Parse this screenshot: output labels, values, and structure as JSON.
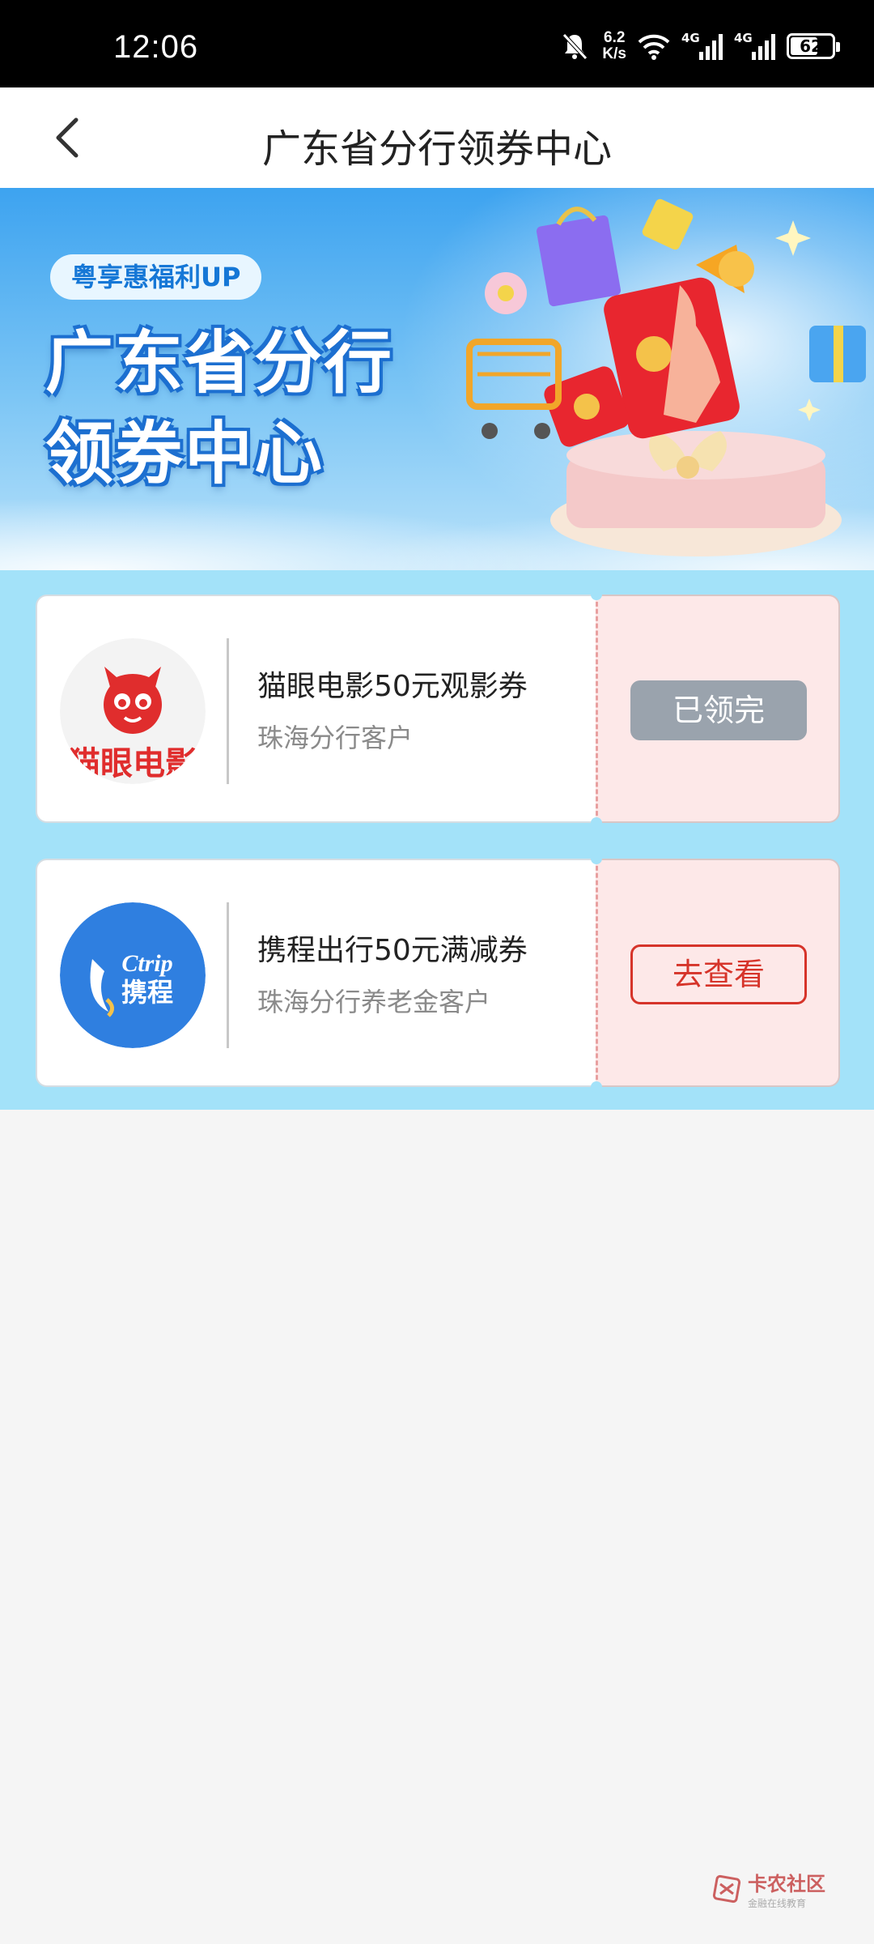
{
  "status_bar": {
    "time": "12:06",
    "net_speed_value": "6.2",
    "net_speed_unit": "K/s",
    "sim1_type": "4G",
    "sim2_type": "4G",
    "battery": "62"
  },
  "header": {
    "title": "广东省分行领券中心"
  },
  "banner": {
    "tag": "粤享惠福利UP",
    "title_line1": "广东省分行",
    "title_line2": "领券中心"
  },
  "coupons": [
    {
      "logo_text": "猫眼电影",
      "name": "猫眼电影50元观影券",
      "subtitle": "珠海分行客户",
      "button": "已领完"
    },
    {
      "logo_text_top": "Ctrip",
      "logo_text_bottom": "携程",
      "name": "携程出行50元满减券",
      "subtitle": "珠海分行养老金客户",
      "button": "去查看"
    }
  ],
  "watermark": {
    "main": "卡农社区",
    "sub": "金融在线教育"
  },
  "colors": {
    "banner_blue": "#3da3f0",
    "coupon_area_bg": "#a3e2f9",
    "claimed_gray": "#9aa3ad",
    "view_red": "#d6342a",
    "maoyan_red": "#e02d2d",
    "ctrip_blue": "#2f7fe0"
  }
}
